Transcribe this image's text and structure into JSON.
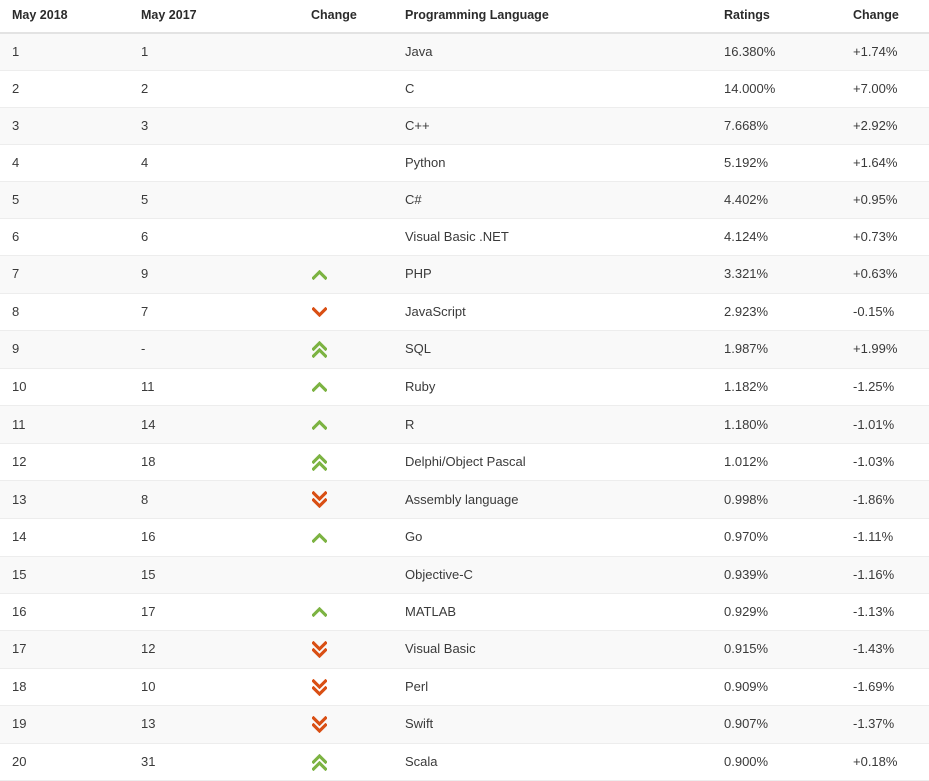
{
  "table": {
    "columns": [
      {
        "key": "rank_new",
        "label": "May 2018"
      },
      {
        "key": "rank_old",
        "label": "May 2017"
      },
      {
        "key": "change_ico",
        "label": "Change"
      },
      {
        "key": "language",
        "label": "Programming Language"
      },
      {
        "key": "ratings",
        "label": "Ratings"
      },
      {
        "key": "change_pct",
        "label": "Change"
      }
    ],
    "colors": {
      "up": "#7cb342",
      "down": "#d94f14",
      "stripe_background": "#f9f9f9",
      "row_background": "#ffffff",
      "row_border": "#ededed",
      "header_border": "#e3e3e3",
      "header_text": "#2b2b2b",
      "body_text": "#3a3a3a"
    },
    "rows": [
      {
        "rank_new": "1",
        "rank_old": "1",
        "change_ico": "none",
        "language": "Java",
        "ratings": "16.380%",
        "change_pct": "+1.74%"
      },
      {
        "rank_new": "2",
        "rank_old": "2",
        "change_ico": "none",
        "language": "C",
        "ratings": "14.000%",
        "change_pct": "+7.00%"
      },
      {
        "rank_new": "3",
        "rank_old": "3",
        "change_ico": "none",
        "language": "C++",
        "ratings": "7.668%",
        "change_pct": "+2.92%"
      },
      {
        "rank_new": "4",
        "rank_old": "4",
        "change_ico": "none",
        "language": "Python",
        "ratings": "5.192%",
        "change_pct": "+1.64%"
      },
      {
        "rank_new": "5",
        "rank_old": "5",
        "change_ico": "none",
        "language": "C#",
        "ratings": "4.402%",
        "change_pct": "+0.95%"
      },
      {
        "rank_new": "6",
        "rank_old": "6",
        "change_ico": "none",
        "language": "Visual Basic .NET",
        "ratings": "4.124%",
        "change_pct": "+0.73%"
      },
      {
        "rank_new": "7",
        "rank_old": "9",
        "change_ico": "up-single",
        "language": "PHP",
        "ratings": "3.321%",
        "change_pct": "+0.63%"
      },
      {
        "rank_new": "8",
        "rank_old": "7",
        "change_ico": "down-single",
        "language": "JavaScript",
        "ratings": "2.923%",
        "change_pct": "-0.15%"
      },
      {
        "rank_new": "9",
        "rank_old": "-",
        "change_ico": "up-double",
        "language": "SQL",
        "ratings": "1.987%",
        "change_pct": "+1.99%"
      },
      {
        "rank_new": "10",
        "rank_old": "11",
        "change_ico": "up-single",
        "language": "Ruby",
        "ratings": "1.182%",
        "change_pct": "-1.25%"
      },
      {
        "rank_new": "11",
        "rank_old": "14",
        "change_ico": "up-single",
        "language": "R",
        "ratings": "1.180%",
        "change_pct": "-1.01%"
      },
      {
        "rank_new": "12",
        "rank_old": "18",
        "change_ico": "up-double",
        "language": "Delphi/Object Pascal",
        "ratings": "1.012%",
        "change_pct": "-1.03%"
      },
      {
        "rank_new": "13",
        "rank_old": "8",
        "change_ico": "down-double",
        "language": "Assembly language",
        "ratings": "0.998%",
        "change_pct": "-1.86%"
      },
      {
        "rank_new": "14",
        "rank_old": "16",
        "change_ico": "up-single",
        "language": "Go",
        "ratings": "0.970%",
        "change_pct": "-1.11%"
      },
      {
        "rank_new": "15",
        "rank_old": "15",
        "change_ico": "none",
        "language": "Objective-C",
        "ratings": "0.939%",
        "change_pct": "-1.16%"
      },
      {
        "rank_new": "16",
        "rank_old": "17",
        "change_ico": "up-single",
        "language": "MATLAB",
        "ratings": "0.929%",
        "change_pct": "-1.13%"
      },
      {
        "rank_new": "17",
        "rank_old": "12",
        "change_ico": "down-double",
        "language": "Visual Basic",
        "ratings": "0.915%",
        "change_pct": "-1.43%"
      },
      {
        "rank_new": "18",
        "rank_old": "10",
        "change_ico": "down-double",
        "language": "Perl",
        "ratings": "0.909%",
        "change_pct": "-1.69%"
      },
      {
        "rank_new": "19",
        "rank_old": "13",
        "change_ico": "down-double",
        "language": "Swift",
        "ratings": "0.907%",
        "change_pct": "-1.37%"
      },
      {
        "rank_new": "20",
        "rank_old": "31",
        "change_ico": "up-double",
        "language": "Scala",
        "ratings": "0.900%",
        "change_pct": "+0.18%"
      }
    ]
  }
}
